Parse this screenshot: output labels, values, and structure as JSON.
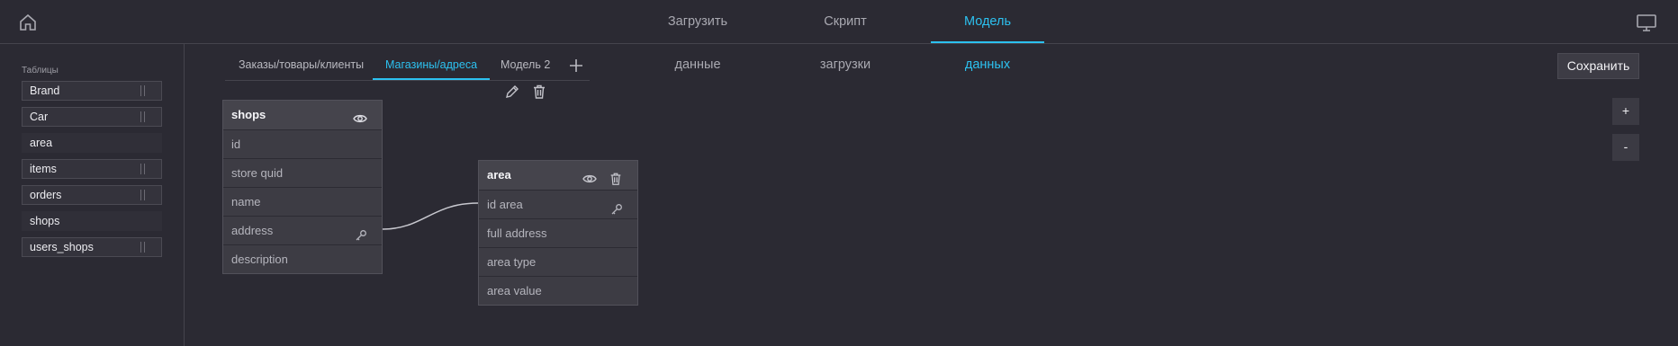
{
  "topnav": {
    "tabs": [
      {
        "label": "Загрузить данные",
        "active": false
      },
      {
        "label": "Скрипт загрузки",
        "active": false
      },
      {
        "label": "Модель данных",
        "active": true
      }
    ],
    "home_icon": "home-icon",
    "monitor_icon": "monitor-icon"
  },
  "sidebar": {
    "title": "Таблицы",
    "tables": [
      {
        "label": "Brand",
        "in_model": true
      },
      {
        "label": "Car",
        "in_model": true
      },
      {
        "label": "area",
        "in_model": false
      },
      {
        "label": "items",
        "in_model": true
      },
      {
        "label": "orders",
        "in_model": true
      },
      {
        "label": "shops",
        "in_model": false
      },
      {
        "label": "users_shops",
        "in_model": true
      }
    ]
  },
  "model_tabs": {
    "tabs": [
      {
        "label": "Заказы/товары/клиенты",
        "active": false
      },
      {
        "label": "Магазины/адреса",
        "active": true
      },
      {
        "label": "Модель 2",
        "active": false
      }
    ],
    "add_icon": "plus-icon",
    "edit_icon": "pencil-icon",
    "delete_icon": "trash-icon"
  },
  "actions": {
    "save_label": "Сохранить",
    "zoom_in_label": "+",
    "zoom_out_label": "-"
  },
  "entities": {
    "shops": {
      "name": "shops",
      "fields": [
        "id",
        "store  quid",
        "name",
        "address",
        "description"
      ]
    },
    "area": {
      "name": "area",
      "fields": [
        "id  area",
        "full  address",
        "area  type",
        "area  value"
      ]
    }
  },
  "relations": [
    {
      "from": "shops.address",
      "to": "area.id  area"
    }
  ],
  "colors": {
    "accent": "#2cc1f0",
    "background": "#2b2a33",
    "panel": "#3d3c44"
  }
}
